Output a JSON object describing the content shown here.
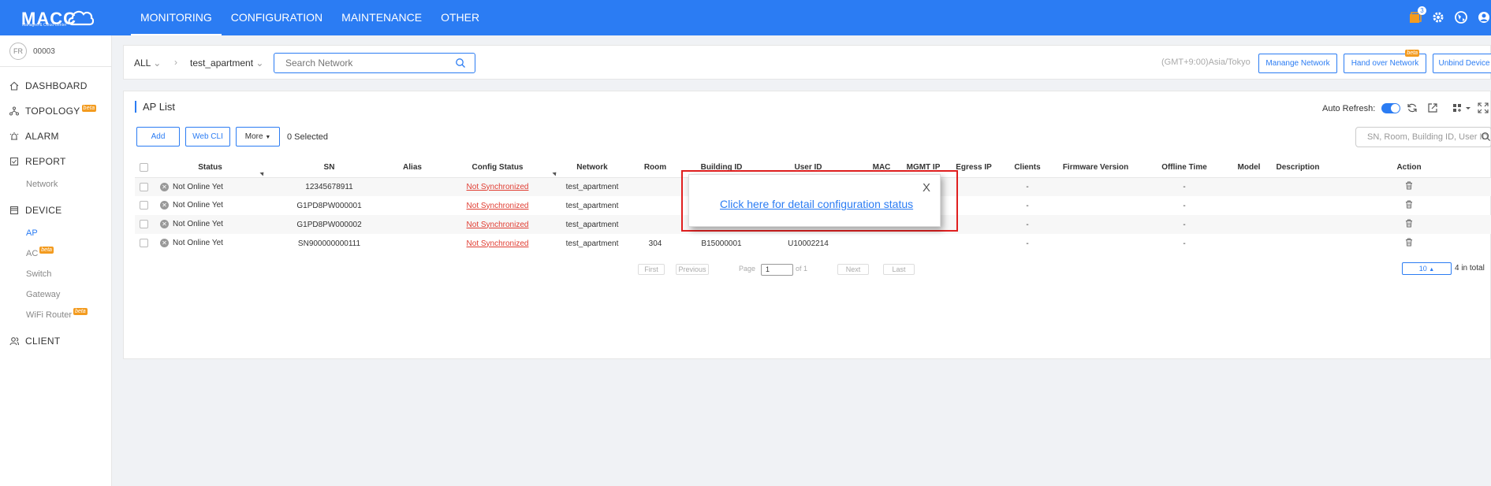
{
  "brand": {
    "name": "MACC",
    "tagline": "Managed & Cloud Center"
  },
  "topnav": [
    "MONITORING",
    "CONFIGURATION",
    "MAINTENANCE",
    "OTHER"
  ],
  "notifications": {
    "count": "3"
  },
  "user": {
    "initials": "FR",
    "id": "00003"
  },
  "sidebar": {
    "dashboard": "DASHBOARD",
    "topology": "TOPOLOGY",
    "alarm": "ALARM",
    "report": "REPORT",
    "report_network": "Network",
    "device": "DEVICE",
    "device_items": [
      "AP",
      "AC",
      "Switch",
      "Gateway",
      "WiFi Router"
    ],
    "client": "CLIENT",
    "beta": "beta"
  },
  "filter": {
    "scope": "ALL",
    "network": "test_apartment",
    "search_placeholder": "Search Network",
    "timezone": "(GMT+9:00)Asia/Tokyo",
    "manage_network": "Manange Network",
    "hand_over": "Hand over Network",
    "unbind": "Unbind Device"
  },
  "panel": {
    "title": "AP List",
    "auto_refresh": "Auto Refresh:",
    "add": "Add",
    "web_cli": "Web CLI",
    "more": "More",
    "selected": "0 Selected",
    "search_placeholder": "SN, Room, Building ID, User ID"
  },
  "table": {
    "columns": [
      "Status",
      "SN",
      "Alias",
      "Config Status",
      "Network",
      "Room",
      "Building ID",
      "User ID",
      "MAC",
      "MGMT IP",
      "Egress IP",
      "Clients",
      "Firmware Version",
      "Offline Time",
      "Model",
      "Description",
      "Action"
    ],
    "rows": [
      {
        "status": "Not Online Yet",
        "sn": "12345678911",
        "config": "Not Synchronized",
        "network": "test_apartment",
        "room": "",
        "building": "",
        "user": "",
        "clients": "-",
        "offline": "-"
      },
      {
        "status": "Not Online Yet",
        "sn": "G1PD8PW000001",
        "config": "Not Synchronized",
        "network": "test_apartment",
        "room": "",
        "building": "",
        "user": "",
        "clients": "-",
        "offline": "-"
      },
      {
        "status": "Not Online Yet",
        "sn": "G1PD8PW000002",
        "config": "Not Synchronized",
        "network": "test_apartment",
        "room": "",
        "building": "",
        "user": "",
        "clients": "-",
        "offline": "-"
      },
      {
        "status": "Not Online Yet",
        "sn": "SN900000000111",
        "config": "Not Synchronized",
        "network": "test_apartment",
        "room": "304",
        "building": "B15000001",
        "user": "U10002214",
        "clients": "-",
        "offline": "-"
      }
    ]
  },
  "pager": {
    "first": "First",
    "previous": "Previous",
    "page_label": "Page",
    "page": "1",
    "of": "of 1",
    "next": "Next",
    "last": "Last",
    "page_size": "10",
    "total": "4 in total"
  },
  "popup": {
    "close": "X",
    "link": "Click here for detail configuration status"
  }
}
